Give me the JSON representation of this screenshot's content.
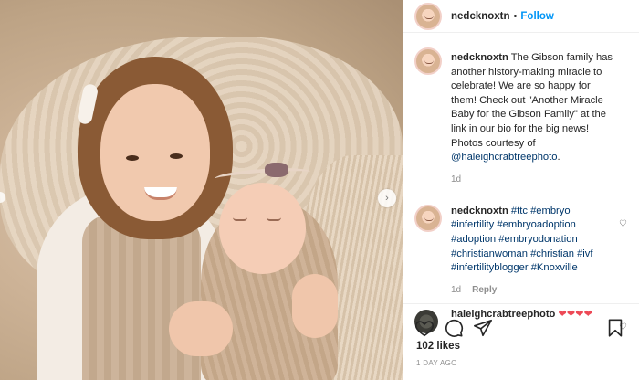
{
  "post": {
    "username": "nedcknoxtn",
    "follow_label": "Follow",
    "separator": "•"
  },
  "caption": {
    "username": "nedcknoxtn",
    "text": "The Gibson family has another history-making miracle to celebrate! We are so happy for them! Check out \"Another Miracle Baby for the Gibson Family\" at the link in our bio for the big news! Photos courtesy of",
    "mention": "@haleighcrabtreephoto",
    "end": ".",
    "time": "1d"
  },
  "hashtags": {
    "username": "nedcknoxtn",
    "tags": [
      "#ttc",
      "#embryo",
      "#infertility",
      "#embryoadoption",
      "#adoption",
      "#embryodonation",
      "#christianwoman",
      "#christian",
      "#ivf",
      "#infertilityblogger",
      "#Knoxville"
    ],
    "time": "1d",
    "reply_label": "Reply"
  },
  "reply": {
    "username": "haleighcrabtreephoto",
    "hearts": "❤❤❤❤"
  },
  "actions": {
    "likes": "102 likes",
    "date": "1 DAY AGO"
  },
  "icons": {
    "like": "heart-icon",
    "comment": "comment-icon",
    "share": "share-icon",
    "save": "bookmark-icon",
    "next": "chevron-right-icon"
  },
  "colors": {
    "link": "#00376b",
    "follow": "#0095f6",
    "heart": "#ed4956",
    "muted": "#8e8e8e"
  }
}
